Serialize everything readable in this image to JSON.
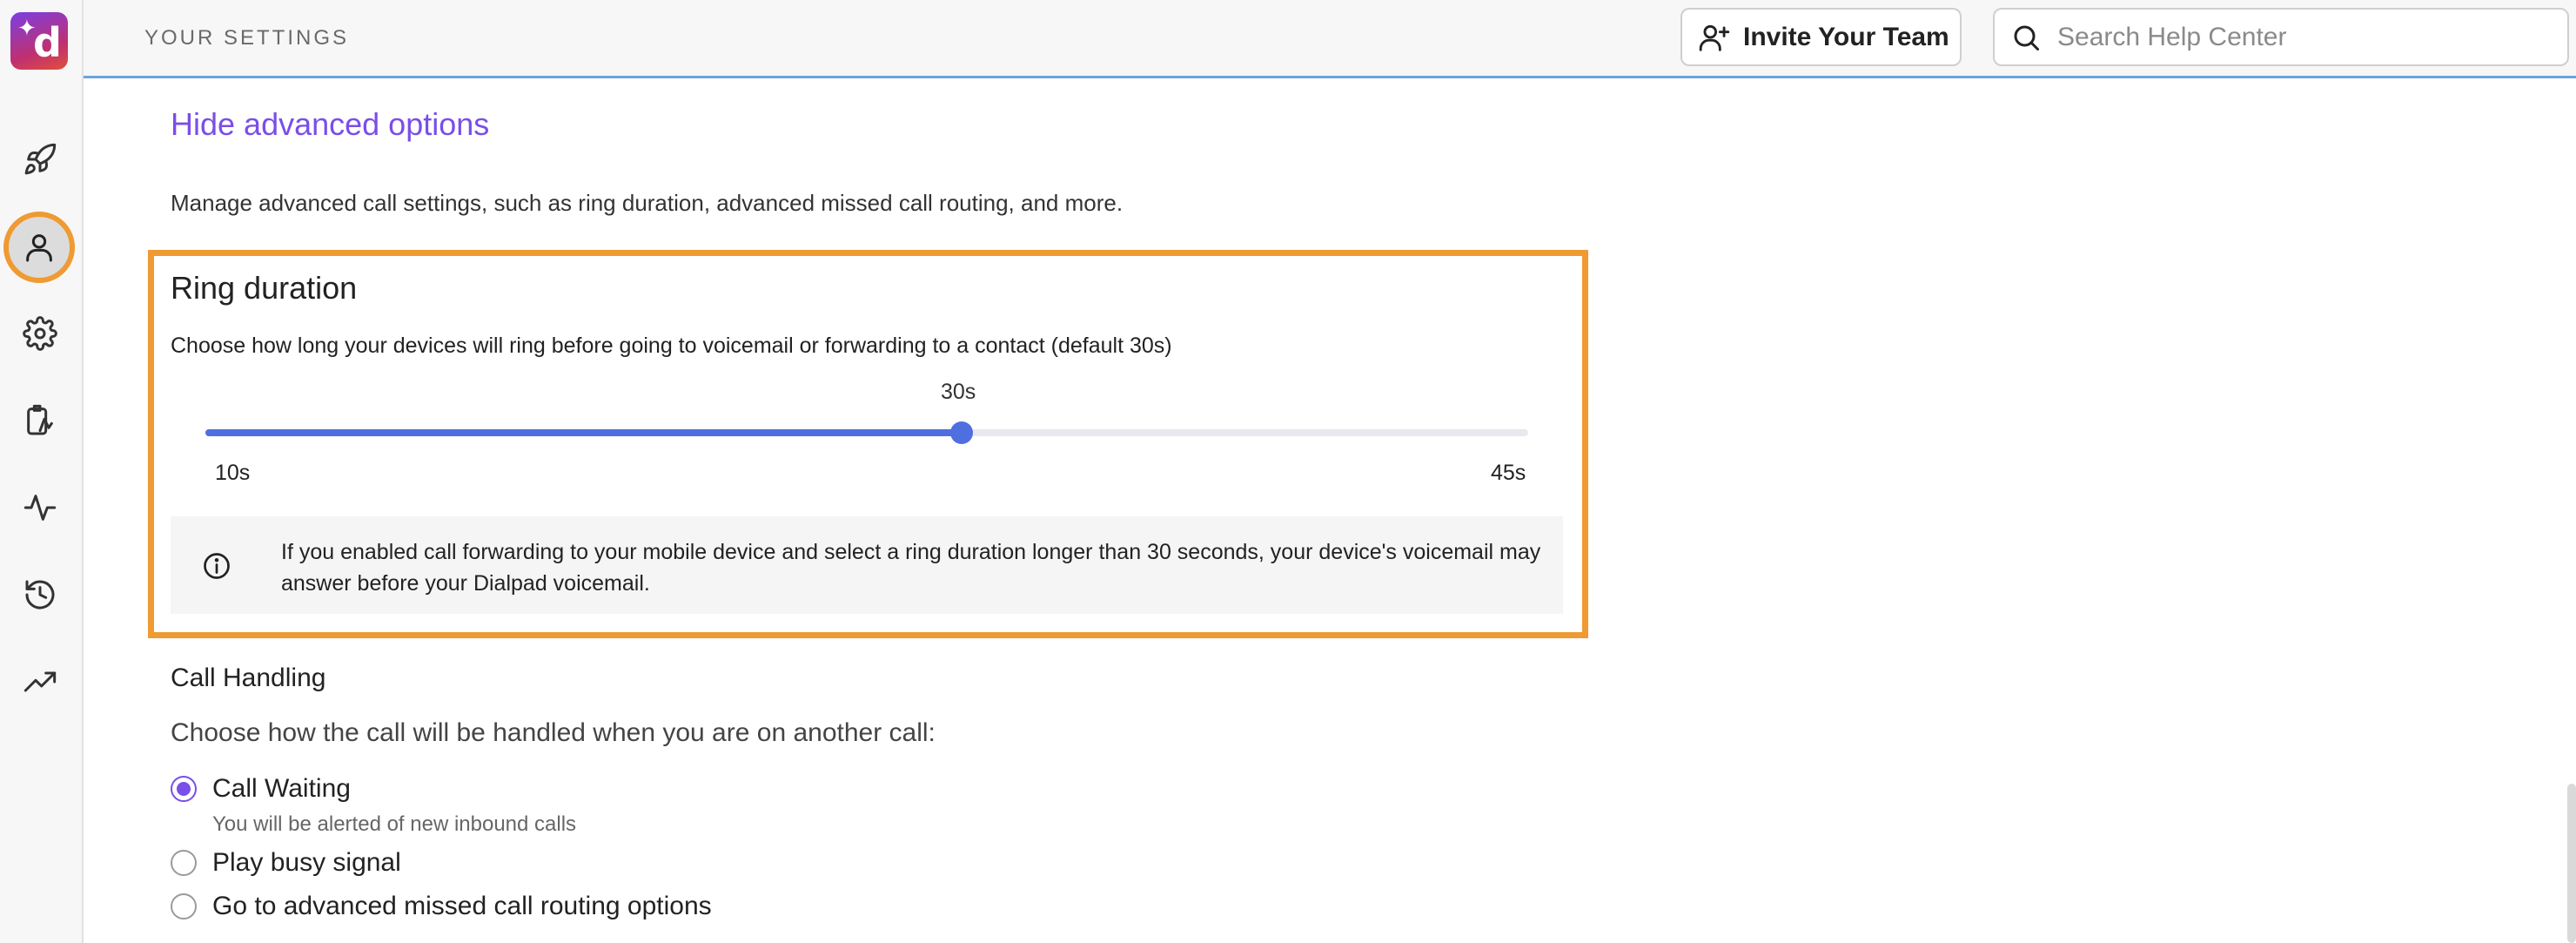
{
  "header": {
    "title": "YOUR SETTINGS",
    "invite_label": "Invite Your Team",
    "search_placeholder": "Search Help Center"
  },
  "sidebar": {
    "logo_icon": "dialpad-logo-icon",
    "items": [
      {
        "icon": "rocket-icon",
        "active": false
      },
      {
        "icon": "user-icon",
        "active": true
      },
      {
        "icon": "gear-icon",
        "active": false
      },
      {
        "icon": "clipboard-icon",
        "active": false
      },
      {
        "icon": "activity-icon",
        "active": false
      },
      {
        "icon": "history-icon",
        "active": false
      },
      {
        "icon": "trending-up-icon",
        "active": false
      }
    ]
  },
  "main": {
    "hide_advanced_label": "Hide advanced options",
    "advanced_description": "Manage advanced call settings, such as ring duration, advanced missed call routing, and more.",
    "ring_duration": {
      "title": "Ring duration",
      "description": "Choose how long your devices will ring before going to voicemail or forwarding to a contact (default 30s)",
      "value_label": "30s",
      "value": 30,
      "min": 10,
      "max": 45,
      "min_label": "10s",
      "max_label": "45s",
      "notice": "If you enabled call forwarding to your mobile device and select a ring duration longer than 30 seconds, your device's voicemail may answer before your Dialpad voicemail."
    },
    "call_handling": {
      "title": "Call Handling",
      "description": "Choose how the call will be handled when you are on another call:",
      "options": [
        {
          "label": "Call Waiting",
          "sublabel": "You will be alerted of new inbound calls",
          "checked": true
        },
        {
          "label": "Play busy signal",
          "checked": false
        },
        {
          "label": "Go to advanced missed call routing options",
          "checked": false
        }
      ]
    }
  },
  "colors": {
    "accent_purple": "#7a4ee8",
    "highlight_orange": "#ef9a32",
    "slider_blue": "#4f6fe0",
    "header_border": "#6ea3dd"
  }
}
